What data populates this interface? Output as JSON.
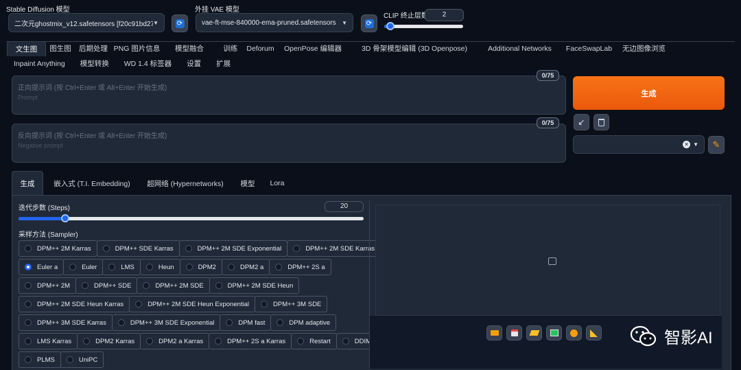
{
  "header": {
    "sd_model_label": "Stable Diffusion 模型",
    "sd_model_value": "二次元ghostmix_v12.safetensors [f20c91bd27]",
    "vae_label": "外挂 VAE 模型",
    "vae_value": "vae-ft-mse-840000-ema-pruned.safetensors",
    "clip_label": "CLIP 终止层数",
    "clip_value": "2",
    "clip_progress": 0.08
  },
  "main_tabs": [
    "文生图",
    "图生图",
    "后期处理",
    "PNG 图片信息",
    "模型融合",
    "训练",
    "Deforum",
    "OpenPose 编辑器",
    "3D 骨架模型编辑 (3D Openpose)",
    "Additional Networks",
    "FaceSwapLab",
    "无边图像浏览",
    "Inpaint Anything",
    "模型转换",
    "WD 1.4 标签器",
    "设置",
    "扩展"
  ],
  "active_tab": "文生图",
  "prompt": {
    "placeholder_cn": "正向提示词 (按 Ctrl+Enter 或 Alt+Enter 开始生成)",
    "placeholder_en": "Prompt",
    "counter": "0/75"
  },
  "negative_prompt": {
    "placeholder_cn": "反向提示词 (按 Ctrl+Enter 或 Alt+Enter 开始生成)",
    "placeholder_en": "Negative prompt",
    "counter": "0/75"
  },
  "generate_label": "生成",
  "sub_tabs": [
    "生成",
    "嵌入式 (T.I. Embedding)",
    "超网络 (Hypernetworks)",
    "模型",
    "Lora"
  ],
  "steps": {
    "label": "迭代步数 (Steps)",
    "value": "20",
    "progress": 0.135
  },
  "sampler": {
    "label": "采样方法 (Sampler)",
    "selected": "Euler a",
    "rows": [
      [
        "DPM++ 2M Karras",
        "DPM++ SDE Karras",
        "DPM++ 2M SDE Exponential",
        "DPM++ 2M SDE Karras"
      ],
      [
        "Euler a",
        "Euler",
        "LMS",
        "Heun",
        "DPM2",
        "DPM2 a",
        "DPM++ 2S a"
      ],
      [
        "DPM++ 2M",
        "DPM++ SDE",
        "DPM++ 2M SDE",
        "DPM++ 2M SDE Heun"
      ],
      [
        "DPM++ 2M SDE Heun Karras",
        "DPM++ 2M SDE Heun Exponential",
        "DPM++ 3M SDE"
      ],
      [
        "DPM++ 3M SDE Karras",
        "DPM++ 3M SDE Exponential",
        "DPM fast",
        "DPM adaptive"
      ],
      [
        "LMS Karras",
        "DPM2 Karras",
        "DPM2 a Karras",
        "DPM++ 2S a Karras",
        "Restart",
        "DDIM"
      ],
      [
        "PLMS",
        "UniPC"
      ]
    ]
  },
  "watermark": "智影AI",
  "colors": {
    "accent": "#2563eb",
    "generate": "#f97316",
    "background": "#0b0f19"
  }
}
